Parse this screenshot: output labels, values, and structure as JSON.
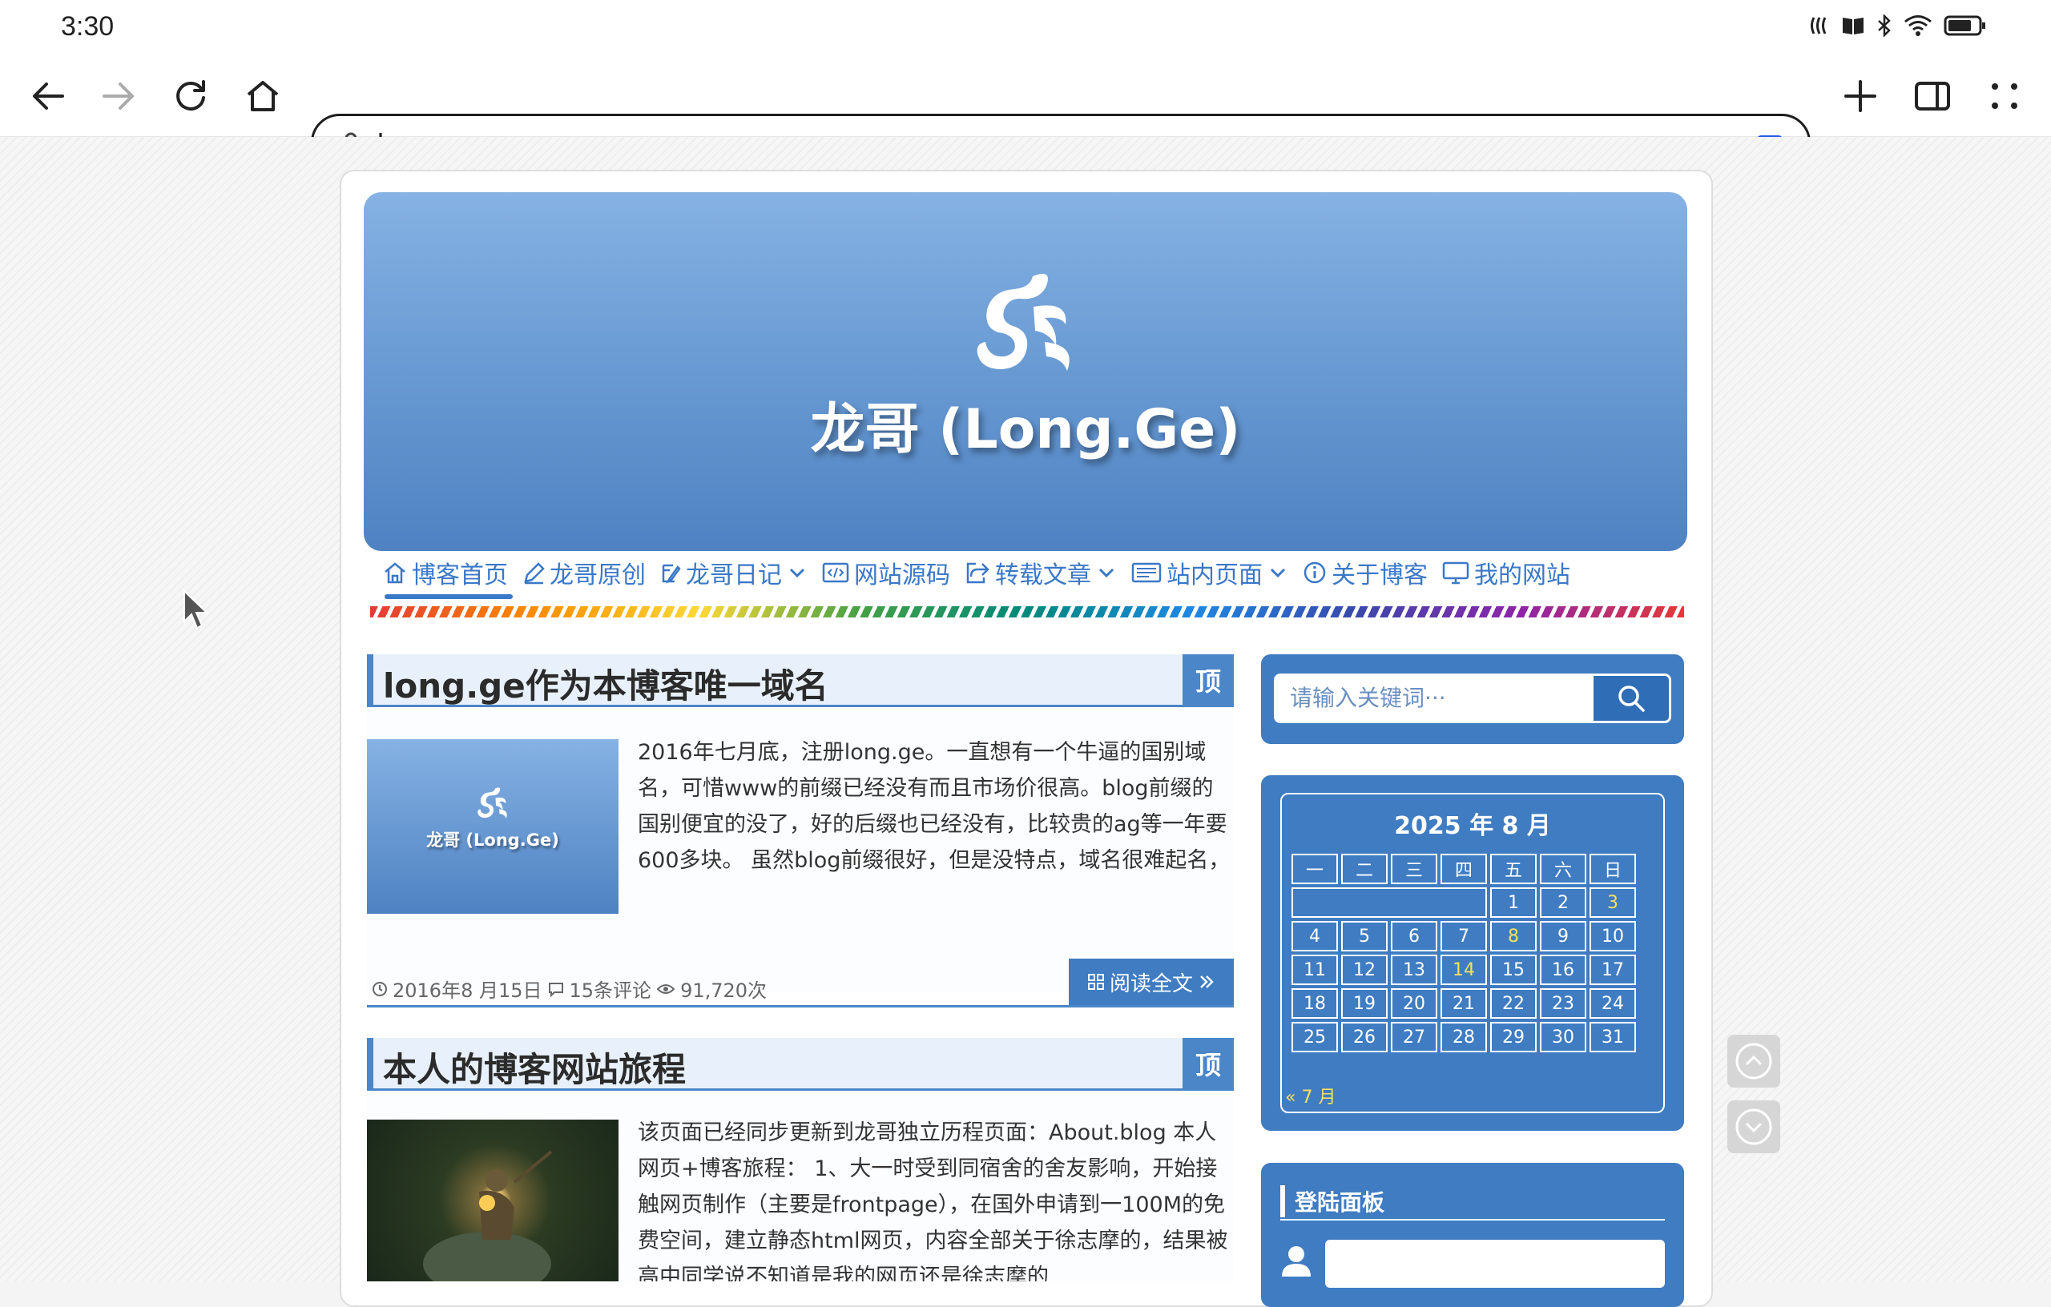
{
  "status_bar": {
    "time": "3:30"
  },
  "browser": {
    "url": "long.ge"
  },
  "site": {
    "title": "龙哥 (Long.Ge)"
  },
  "nav": [
    {
      "label": "博客首页",
      "icon": "home-icon",
      "active": true
    },
    {
      "label": "龙哥原创",
      "icon": "pen-icon"
    },
    {
      "label": "龙哥日记",
      "icon": "edit-icon",
      "dropdown": true
    },
    {
      "label": "网站源码",
      "icon": "code-icon"
    },
    {
      "label": "转载文章",
      "icon": "share-icon",
      "dropdown": true
    },
    {
      "label": "站内页面",
      "icon": "page-icon",
      "dropdown": true
    },
    {
      "label": "关于博客",
      "icon": "info-icon"
    },
    {
      "label": "我的网站",
      "icon": "monitor-icon"
    }
  ],
  "posts": [
    {
      "title": "long.ge作为本博客唯一域名",
      "sticky": "顶",
      "thumb_title": "龙哥 (Long.Ge)",
      "excerpt": "2016年七月底，注册long.ge。一直想有一个牛逼的国别域名，可惜www的前缀已经没有而且市场价很高。blog前缀的国别便宜的没了，好的后缀也已经没有，比较贵的ag等一年要600多块。 虽然blog前缀很好，但是没特点，域名很难起名，主要是太贵。于是想到了域名long前缀的域",
      "date": "2016年8 月15日",
      "comments": "15条评论",
      "views": "91,720次",
      "read_more": "阅读全文"
    },
    {
      "title": "本人的博客网站旅程",
      "sticky": "顶",
      "excerpt": "该页面已经同步更新到龙哥独立历程页面：About.blog 本人网页+博客旅程： 1、大一时受到同宿舍的舍友影响，开始接触网页制作（主要是frontpage），在国外申请到一100M的免费空间，建立静态html网页，内容全部关于徐志摩的，结果被高中同学说不知道是我的网页还是徐志摩的"
    }
  ],
  "sidebar": {
    "search_placeholder": "请输入关键词···",
    "calendar": {
      "title": "2025 年 8 月",
      "weekdays": [
        "一",
        "二",
        "三",
        "四",
        "五",
        "六",
        "日"
      ],
      "weeks": [
        [
          "",
          "",
          "",
          "",
          "1",
          "2",
          "3"
        ],
        [
          "4",
          "5",
          "6",
          "7",
          "8",
          "9",
          "10"
        ],
        [
          "11",
          "12",
          "13",
          "14",
          "15",
          "16",
          "17"
        ],
        [
          "18",
          "19",
          "20",
          "21",
          "22",
          "23",
          "24"
        ],
        [
          "25",
          "26",
          "27",
          "28",
          "29",
          "30",
          "31"
        ]
      ],
      "highlighted": [
        "3",
        "8",
        "14"
      ],
      "prev_link": "« 7 月"
    },
    "login_title": "登陆面板"
  }
}
